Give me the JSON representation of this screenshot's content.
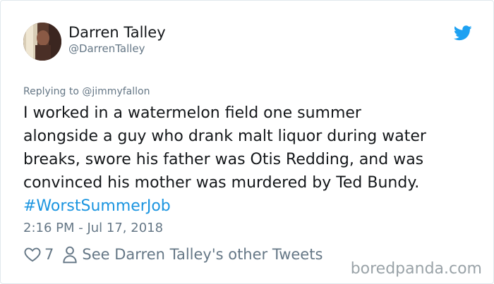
{
  "user": {
    "display_name": "Darren Talley",
    "handle": "@DarrenTalley"
  },
  "reply": {
    "prefix": "Replying to ",
    "mention": "@jimmyfallon"
  },
  "tweet": {
    "lines": [
      "I worked in a watermelon field one summer",
      "alongside a guy who drank malt liquor during water",
      "breaks, swore his father was Otis Redding, and was",
      "convinced his mother was murdered by Ted Bundy."
    ],
    "hashtag": "#WorstSummerJob"
  },
  "timestamp": "2:16 PM - Jul 17, 2018",
  "actions": {
    "like_count": "7",
    "other_tweets_label": "See Darren Talley's other Tweets"
  },
  "watermark": "boredpanda.com",
  "icons": {
    "brand": "twitter-bird-icon",
    "like": "heart-icon",
    "profile": "person-icon"
  },
  "colors": {
    "brand_blue": "#1da1f2",
    "hashtag_blue": "#1b95e0",
    "secondary_text": "#657786",
    "primary_text": "#14171a"
  }
}
